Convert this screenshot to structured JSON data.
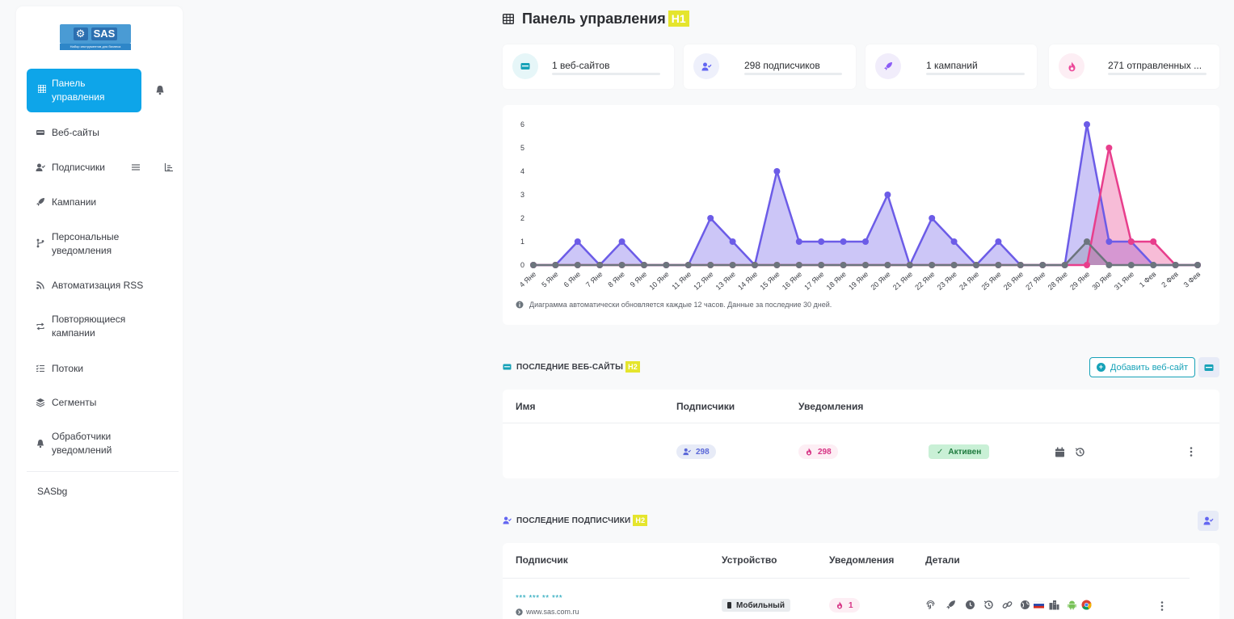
{
  "sidebar": {
    "logo_text": "SAS",
    "logo_tagline": "Набор инструментов для бизнеса",
    "active_item": "Панель управления",
    "items": [
      {
        "label": "Веб-сайты",
        "icon": "website-icon"
      },
      {
        "label": "Подписчики",
        "icon": "user-check-icon"
      },
      {
        "label": "Кампании",
        "icon": "rocket-icon"
      },
      {
        "label": "Персональные уведомления",
        "icon": "branch-icon"
      },
      {
        "label": "Автоматизация RSS",
        "icon": "rss-icon"
      },
      {
        "label": "Повторяющиеся кампании",
        "icon": "repeat-icon"
      },
      {
        "label": "Потоки",
        "icon": "list-check-icon"
      },
      {
        "label": "Сегменты",
        "icon": "layers-icon"
      },
      {
        "label": "Обработчики уведомлений",
        "icon": "bell-icon"
      }
    ],
    "user": "SASbg"
  },
  "header": {
    "title": "Панель управления",
    "badge": "H1"
  },
  "stats": [
    {
      "text": "1 веб-сайтов",
      "icon": "website-icon",
      "color": "#17a2b8"
    },
    {
      "text": "298 подписчиков",
      "icon": "user-check-icon",
      "color": "#6366f1"
    },
    {
      "text": "1 кампаний",
      "icon": "rocket-icon",
      "color": "#8b5cf6"
    },
    {
      "text": "271 отправленных ...",
      "icon": "fire-icon",
      "color": "#ec4899"
    }
  ],
  "chart_data": {
    "type": "area",
    "categories": [
      "4 Яне",
      "5 Яне",
      "6 Яне",
      "7 Яне",
      "8 Яне",
      "9 Яне",
      "10 Яне",
      "11 Яне",
      "12 Яне",
      "13 Яне",
      "14 Яне",
      "15 Яне",
      "16 Яне",
      "17 Яне",
      "18 Яне",
      "19 Яне",
      "20 Яне",
      "21 Яне",
      "22 Яне",
      "23 Яне",
      "24 Яне",
      "25 Яне",
      "26 Яне",
      "27 Яне",
      "28 Яне",
      "29 Яне",
      "30 Яне",
      "31 Яне",
      "1 Фев",
      "2 Фев",
      "3 Фев"
    ],
    "ylim": [
      0,
      6
    ],
    "yticks": [
      "0",
      "1",
      "2",
      "3",
      "4",
      "5",
      "6"
    ],
    "series": [
      {
        "color": "#6c5ce7",
        "values": [
          0,
          0,
          1,
          0,
          1,
          0,
          0,
          0,
          2,
          1,
          0,
          4,
          1,
          1,
          1,
          1,
          3,
          0,
          2,
          1,
          0,
          1,
          0,
          0,
          0,
          6,
          1,
          1,
          0,
          0,
          0
        ]
      },
      {
        "color": "#e83e8c",
        "values": [
          0,
          0,
          0,
          0,
          0,
          0,
          0,
          0,
          0,
          0,
          0,
          0,
          0,
          0,
          0,
          0,
          0,
          0,
          0,
          0,
          0,
          0,
          0,
          0,
          0,
          0,
          5,
          1,
          1,
          0,
          0
        ]
      },
      {
        "color": "#6c757d",
        "values": [
          0,
          0,
          0,
          0,
          0,
          0,
          0,
          0,
          0,
          0,
          0,
          0,
          0,
          0,
          0,
          0,
          0,
          0,
          0,
          0,
          0,
          0,
          0,
          0,
          0,
          1,
          0,
          0,
          0,
          0,
          0
        ]
      }
    ]
  },
  "chart_note": "Диаграмма автоматически обновляется каждые 12 часов. Данные за последние 30 дней.",
  "websites": {
    "title": "ПОСЛЕДНИЕ ВЕБ-САЙТЫ",
    "badge": "H2",
    "add_label": "Добавить веб-сайт",
    "columns": [
      "Имя",
      "Подписчики",
      "Уведомления"
    ],
    "row": {
      "subscribers": "298",
      "notifications": "298",
      "status": "Активен"
    }
  },
  "subscribers": {
    "title": "ПОСЛЕДНИЕ ПОДПИСЧИКИ",
    "badge": "H2",
    "columns": [
      "Подписчик",
      "Устройство",
      "Уведомления",
      "Детали"
    ],
    "row": {
      "name": "*** *** ** ***",
      "site": "www.sas.com.ru",
      "device": "Мобильный",
      "notifications": "1"
    }
  }
}
